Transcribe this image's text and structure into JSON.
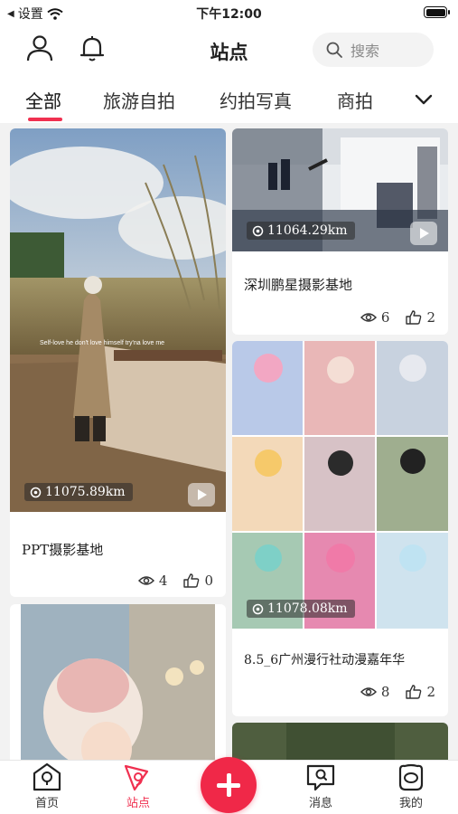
{
  "status": {
    "carrier": "设置",
    "time": "下午12:00"
  },
  "header": {
    "title": "站点",
    "search_placeholder": "搜索"
  },
  "tabs": [
    {
      "label": "全部",
      "active": true
    },
    {
      "label": "旅游自拍",
      "active": false
    },
    {
      "label": "约拍写真",
      "active": false
    },
    {
      "label": "商拍",
      "active": false
    }
  ],
  "cards": [
    {
      "title": "PPT摄影基地",
      "distance": "11075.89km",
      "views": "4",
      "likes": "0",
      "video": true
    },
    {
      "title": "深圳鹏星摄影基地",
      "distance": "11064.29km",
      "views": "6",
      "likes": "2",
      "video": true
    },
    {
      "title": "8.5_6广州漫行社动漫嘉年华",
      "distance": "11078.08km",
      "views": "8",
      "likes": "2",
      "video": false
    }
  ],
  "photo_caption": "Self-love he don't love himself try'na love me",
  "nav": [
    {
      "label": "首页",
      "icon": "home-icon",
      "active": false
    },
    {
      "label": "站点",
      "icon": "site-icon",
      "active": true
    },
    {
      "label": "",
      "icon": "plus-icon",
      "active": false
    },
    {
      "label": "消息",
      "icon": "message-icon",
      "active": false
    },
    {
      "label": "我的",
      "icon": "profile-icon",
      "active": false
    }
  ],
  "colors": {
    "accent": "#f03050",
    "fab": "#f02848",
    "feed_bg": "#f2f2f2"
  }
}
